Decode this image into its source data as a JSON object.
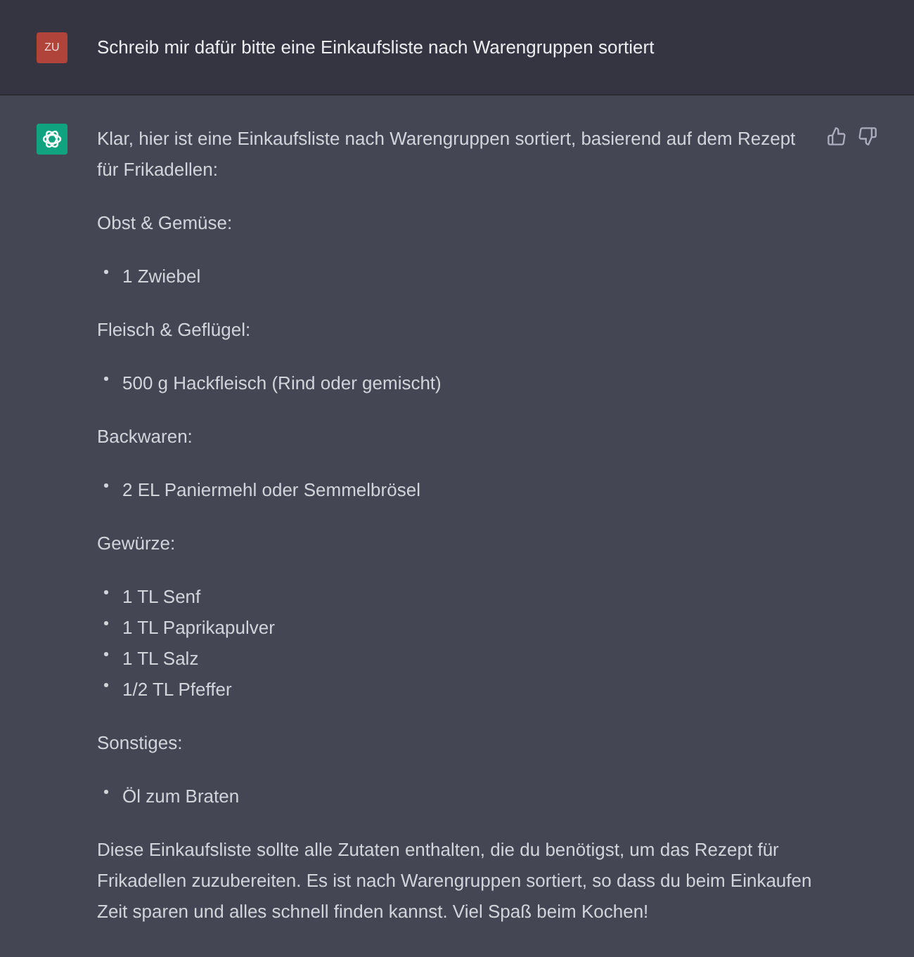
{
  "user_message": {
    "avatar": "ZU",
    "text": "Schreib mir dafür bitte eine Einkaufsliste nach Warengruppen sortiert"
  },
  "assistant_message": {
    "intro": "Klar, hier ist eine Einkaufsliste nach Warengruppen sortiert, basierend auf dem Rezept für Frikadellen:",
    "sections": [
      {
        "heading": "Obst & Gemüse:",
        "items": [
          "1 Zwiebel"
        ]
      },
      {
        "heading": "Fleisch & Geflügel:",
        "items": [
          "500 g Hackfleisch (Rind oder gemischt)"
        ]
      },
      {
        "heading": "Backwaren:",
        "items": [
          "2 EL Paniermehl oder Semmelbrösel"
        ]
      },
      {
        "heading": "Gewürze:",
        "items": [
          "1 TL Senf",
          "1 TL Paprikapulver",
          "1 TL Salz",
          "1/2 TL Pfeffer"
        ]
      },
      {
        "heading": "Sonstiges:",
        "items": [
          "Öl zum Braten"
        ]
      }
    ],
    "outro": "Diese Einkaufsliste sollte alle Zutaten enthalten, die du benötigst, um das Rezept für Frikadellen zuzubereiten. Es ist nach Warengruppen sortiert, so dass du beim Einkaufen Zeit sparen und alles schnell finden kannst. Viel Spaß beim Kochen!"
  }
}
